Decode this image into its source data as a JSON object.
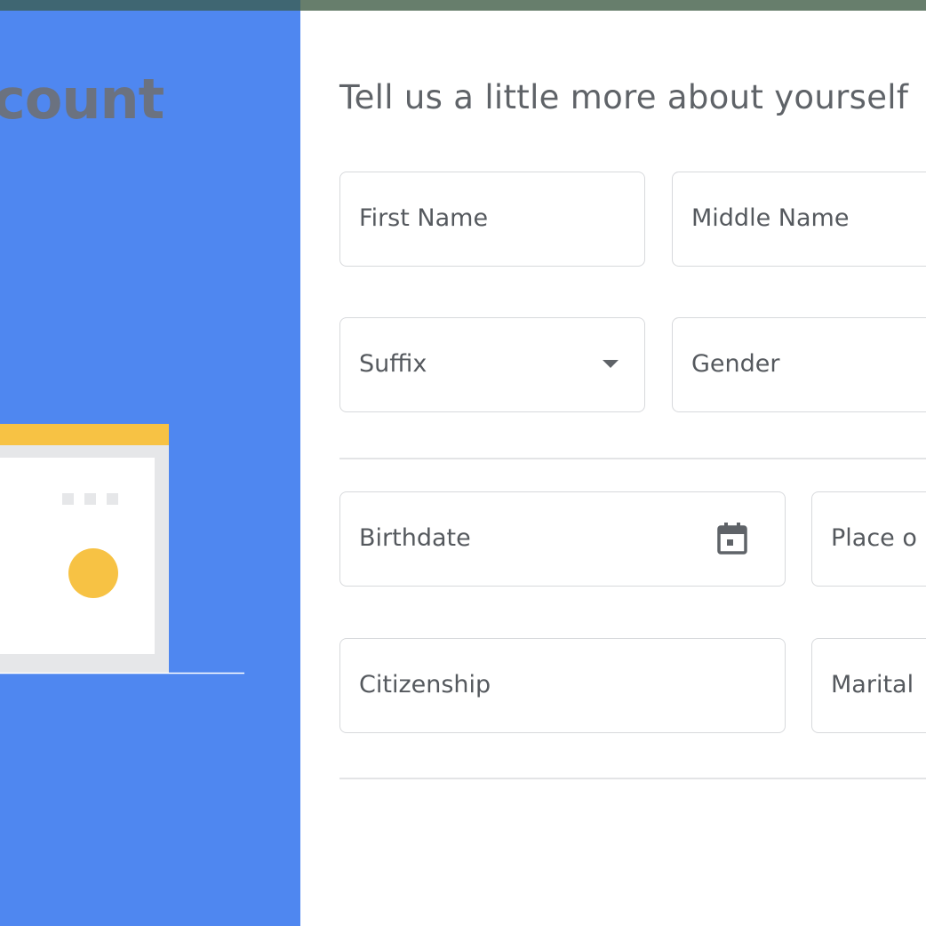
{
  "left": {
    "title": "count"
  },
  "form": {
    "heading": "Tell us a little more about yourself",
    "first_name": "First Name",
    "middle_name": "Middle Name",
    "suffix": "Suffix",
    "gender": "Gender",
    "birthdate": "Birthdate",
    "place_of_birth": "Place o",
    "citizenship": "Citizenship",
    "marital_status": "Marital"
  },
  "colors": {
    "left_panel": "#4f87f0",
    "accent_yellow": "#f7c244",
    "text_gray": "#5f6368",
    "border": "#d7d9dc"
  },
  "icons": {
    "suffix_trailing": "dropdown-arrow-icon",
    "birthdate_trailing": "calendar-icon"
  }
}
